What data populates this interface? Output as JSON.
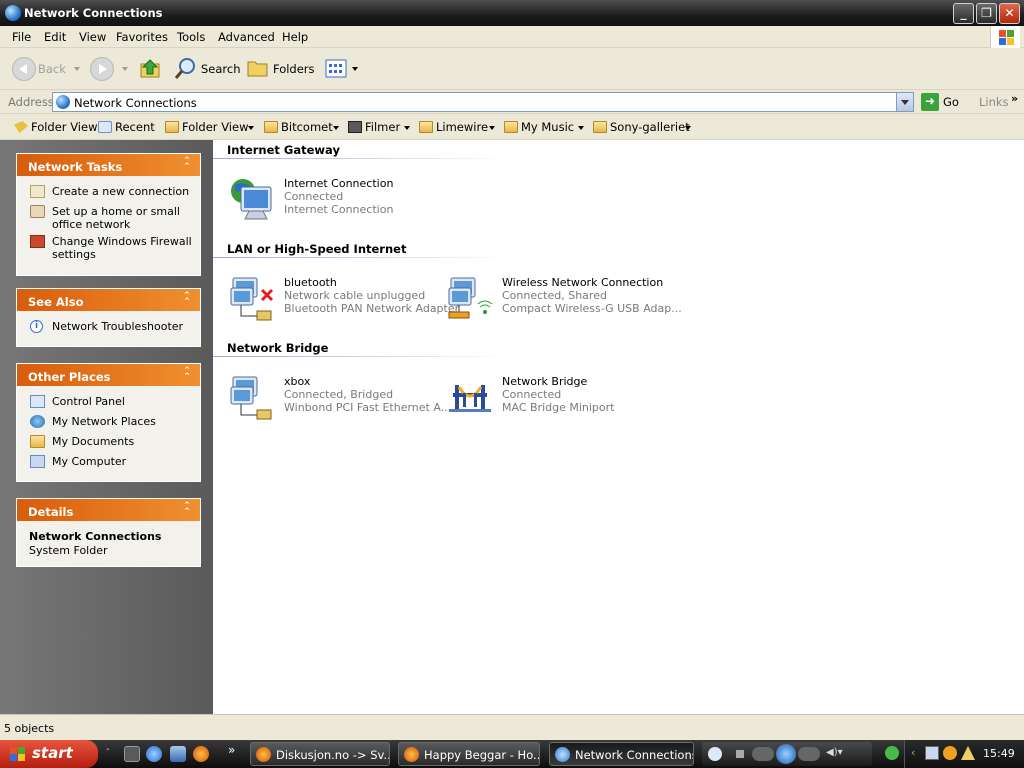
{
  "window": {
    "title": "Network Connections"
  },
  "menu": [
    "File",
    "Edit",
    "View",
    "Favorites",
    "Tools",
    "Advanced",
    "Help"
  ],
  "toolbar": {
    "back": "Back",
    "search": "Search",
    "folders": "Folders"
  },
  "address": {
    "label": "Address",
    "value": "Network Connections",
    "go": "Go",
    "links": "Links"
  },
  "links": [
    "Folder View",
    "Recent",
    "Folder View",
    "Bitcomet",
    "Filmer",
    "Limewire",
    "My Music",
    "Sony-galleriet"
  ],
  "sidebar": {
    "network_tasks": {
      "title": "Network Tasks",
      "items": [
        "Create a new connection",
        "Set up a home or small",
        "office network",
        "Change Windows Firewall",
        "settings"
      ]
    },
    "see_also": {
      "title": "See Also",
      "items": [
        "Network Troubleshooter"
      ]
    },
    "other_places": {
      "title": "Other Places",
      "items": [
        "Control Panel",
        "My Network Places",
        "My Documents",
        "My Computer"
      ]
    },
    "details": {
      "title": "Details",
      "name": "Network Connections",
      "type": "System Folder"
    }
  },
  "groups": [
    {
      "title": "Internet Gateway",
      "items": [
        {
          "name": "Internet Connection",
          "status": "Connected",
          "device": "Internet Connection"
        }
      ]
    },
    {
      "title": "LAN or High-Speed Internet",
      "items": [
        {
          "name": "bluetooth",
          "status": "Network cable unplugged",
          "device": "Bluetooth PAN Network Adapter"
        },
        {
          "name": "Wireless Network Connection",
          "status": "Connected, Shared",
          "device": "Compact Wireless-G USB Adap..."
        }
      ]
    },
    {
      "title": "Network Bridge",
      "items": [
        {
          "name": "xbox",
          "status": "Connected, Bridged",
          "device": "Winbond PCI Fast Ethernet A..."
        },
        {
          "name": "Network Bridge",
          "status": "Connected",
          "device": "MAC Bridge Miniport"
        }
      ]
    }
  ],
  "status": {
    "text": "5 objects"
  },
  "taskbar": {
    "start": "start",
    "tasks": [
      "Diskusjon.no -> Sv...",
      "Happy Beggar - Ho...",
      "Network Connections"
    ],
    "clock": "15:49"
  }
}
